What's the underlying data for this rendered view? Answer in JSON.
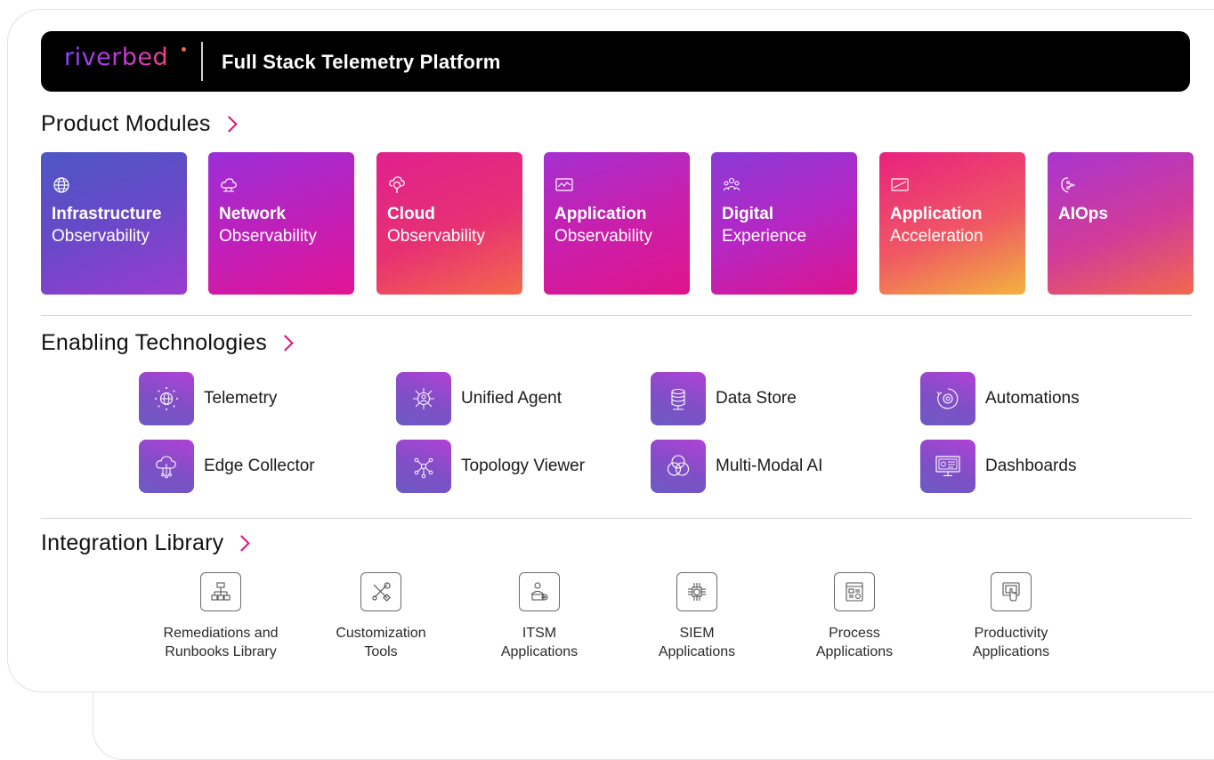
{
  "header": {
    "logo_text": "riverbed",
    "title": "Full Stack Telemetry Platform",
    "logo_gradient": [
      "#8b45ff",
      "#c13bd8",
      "#f0438a"
    ]
  },
  "sections": {
    "product_modules": "Product Modules",
    "enabling_technologies": "Enabling Technologies",
    "integration_library": "Integration Library"
  },
  "product_modules": [
    {
      "line1": "Infrastructure",
      "line2": "Observability",
      "icon": "globe-icon"
    },
    {
      "line1": "Network",
      "line2": "Observability",
      "icon": "cloud-network-icon"
    },
    {
      "line1": "Cloud",
      "line2": "Observability",
      "icon": "cloud-search-icon"
    },
    {
      "line1": "Application",
      "line2": "Observability",
      "icon": "monitor-chart-icon"
    },
    {
      "line1": "Digital",
      "line2": "Experience",
      "icon": "users-icon"
    },
    {
      "line1": "Application",
      "line2": "Acceleration",
      "icon": "speed-screen-icon"
    },
    {
      "line1": "AIOps",
      "line2": "",
      "icon": "ai-brain-icon"
    }
  ],
  "enabling_technologies": [
    {
      "label": "Telemetry",
      "icon": "telemetry-globe-icon"
    },
    {
      "label": "Unified Agent",
      "icon": "agent-hub-icon"
    },
    {
      "label": "Data Store",
      "icon": "database-icon"
    },
    {
      "label": "Automations",
      "icon": "gear-cycle-icon"
    },
    {
      "label": "Edge Collector",
      "icon": "cloud-collector-icon"
    },
    {
      "label": "Topology Viewer",
      "icon": "topology-icon"
    },
    {
      "label": "Multi-Modal AI",
      "icon": "venn-icon"
    },
    {
      "label": "Dashboards",
      "icon": "dashboard-monitor-icon"
    }
  ],
  "integration_library": [
    {
      "line1": "Remediations and",
      "line2": "Runbooks Library",
      "icon": "hierarchy-icon"
    },
    {
      "line1": "Customization",
      "line2": "Tools",
      "icon": "tools-icon"
    },
    {
      "line1": "ITSM",
      "line2": "Applications",
      "icon": "service-user-icon"
    },
    {
      "line1": "SIEM",
      "line2": "Applications",
      "icon": "security-chip-icon"
    },
    {
      "line1": "Process",
      "line2": "Applications",
      "icon": "process-window-icon"
    },
    {
      "line1": "Productivity",
      "line2": "Applications",
      "icon": "touch-screen-icon"
    }
  ],
  "colors": {
    "accent_chevron": "#e0127a",
    "header_bg": "#000000"
  }
}
